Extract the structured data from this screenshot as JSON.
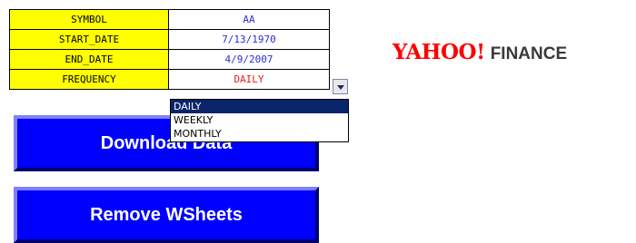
{
  "params": [
    {
      "label": "SYMBOL",
      "value": "AA"
    },
    {
      "label": "START_DATE",
      "value": "7/13/1970"
    },
    {
      "label": "END_DATE",
      "value": "4/9/2007"
    },
    {
      "label": "FREQUENCY",
      "value": "DAILY"
    }
  ],
  "frequency_dropdown": {
    "options": [
      "DAILY",
      "WEEKLY",
      "MONTHLY"
    ],
    "selected": "DAILY"
  },
  "buttons": {
    "download_label": "Download Data",
    "remove_label": "Remove WSheets"
  },
  "logo": {
    "yahoo_text": "YAHOO!",
    "finance_text": "FINANCE"
  },
  "colors": {
    "label_bg": "#ffff00",
    "value_text": "#2b2bd6",
    "frequency_text": "#e02020",
    "button_bg": "#0000ff",
    "logo_red": "#ff0000"
  }
}
